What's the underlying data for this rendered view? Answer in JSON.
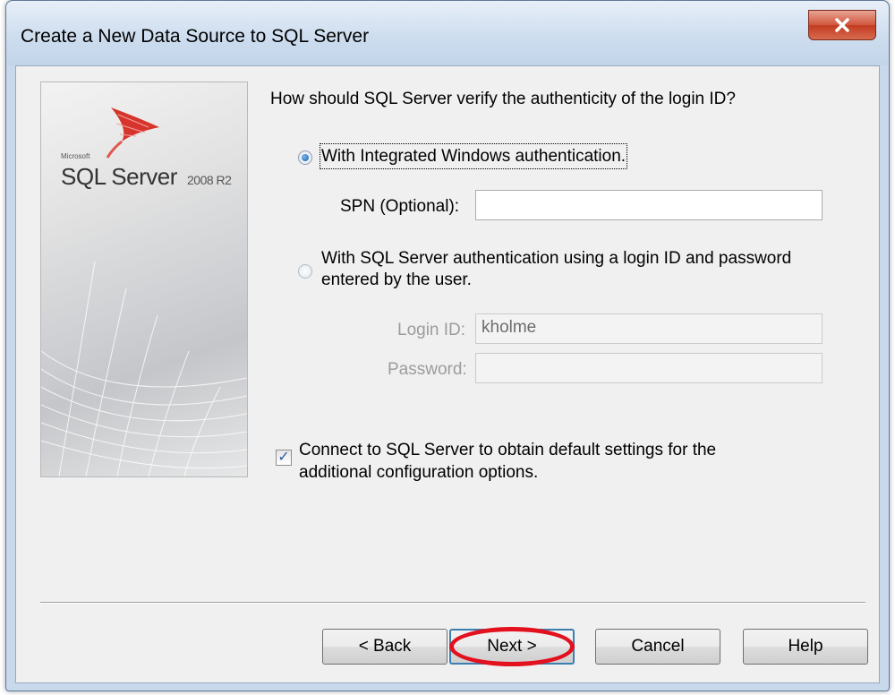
{
  "window": {
    "title": "Create a New Data Source to SQL Server",
    "close_icon": "close-icon"
  },
  "banner": {
    "ms_text": "Microsoft",
    "product": "SQL Server",
    "version": "2008 R2"
  },
  "question": "How should SQL Server verify the authenticity of the login ID?",
  "auth": {
    "windows_label": "With Integrated Windows authentication.",
    "windows_selected": true,
    "spn_label": "SPN (Optional):",
    "spn_value": "",
    "sql_label_line1": "With SQL Server authentication using a login ID and password",
    "sql_label_line2": "entered by the user.",
    "sql_selected": false,
    "login_label": "Login ID:",
    "login_value": "kholme",
    "password_label": "Password:",
    "password_value": ""
  },
  "connect": {
    "checked": true,
    "check_glyph": "✓",
    "label_line1": "Connect to SQL Server to obtain default settings for the",
    "label_line2": "additional configuration options."
  },
  "buttons": {
    "back": "< Back",
    "next": "Next >",
    "cancel": "Cancel",
    "help": "Help"
  },
  "colors": {
    "highlight": "#e3101d",
    "accent": "#3c7fb1"
  }
}
